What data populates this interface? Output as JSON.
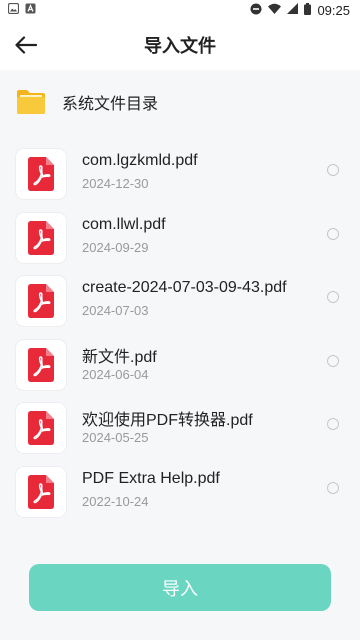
{
  "status_bar": {
    "time": "09:25",
    "left_icons": [
      "image-icon",
      "a-letter-icon"
    ],
    "right_icons": [
      "do-not-disturb-icon",
      "wifi-icon",
      "signal-icon",
      "battery-icon"
    ]
  },
  "header": {
    "title": "导入文件",
    "back_icon": "arrow-left-icon"
  },
  "directory": {
    "label": "系统文件目录",
    "icon": "folder-icon"
  },
  "files": [
    {
      "name": "com.lgzkmld.pdf",
      "date": "2024-12-30",
      "selected": false
    },
    {
      "name": "com.llwl.pdf",
      "date": "2024-09-29",
      "selected": false
    },
    {
      "name": "create-2024-07-03-09-43.pdf",
      "date": "2024-07-03",
      "selected": false
    },
    {
      "name": "新文件.pdf",
      "date": "2024-06-04",
      "selected": false
    },
    {
      "name": "欢迎使用PDF转换器.pdf",
      "date": "2024-05-25",
      "selected": false
    },
    {
      "name": "PDF Extra Help.pdf",
      "date": "2022-10-24",
      "selected": false
    }
  ],
  "import_button": {
    "label": "导入"
  },
  "colors": {
    "accent": "#6ad6c2",
    "pdf_red": "#e8293a",
    "folder_yellow": "#f6c12a",
    "content_bg": "#f6f7f9"
  }
}
